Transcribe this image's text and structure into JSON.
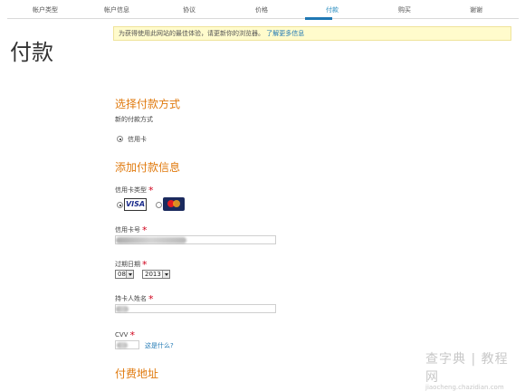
{
  "steps": [
    "帐户类型",
    "帐户信息",
    "协议",
    "价格",
    "付款",
    "购买",
    "谢谢"
  ],
  "active_step": "付款",
  "page_title": "付款",
  "notice": {
    "text": "为获得使用此网站的最佳体验，请更新你的浏览器。",
    "link": "了解更多信息"
  },
  "payment_method": {
    "title": "选择付款方式",
    "subtitle": "新的付款方式",
    "option": "信用卡"
  },
  "payment_info": {
    "title": "添加付款信息",
    "card_type_label": "信用卡类型",
    "card_types": [
      "VISA",
      "MasterCard"
    ],
    "card_number_label": "信用卡号",
    "expiry_label": "过期日期",
    "expiry_month": "08",
    "expiry_year": "2013",
    "holder_label": "持卡人姓名",
    "cvv_label": "CVV",
    "cvv_help": "这是什么?"
  },
  "billing_title": "付费地址",
  "watermark": {
    "line1": "查字典 | 教程网",
    "line2": "jiaocheng.chazidian.com"
  },
  "colors": {
    "accent": "#e07a0e",
    "link": "#1f78b4",
    "notice_bg": "#fffbcc",
    "required": "#d0021b"
  }
}
